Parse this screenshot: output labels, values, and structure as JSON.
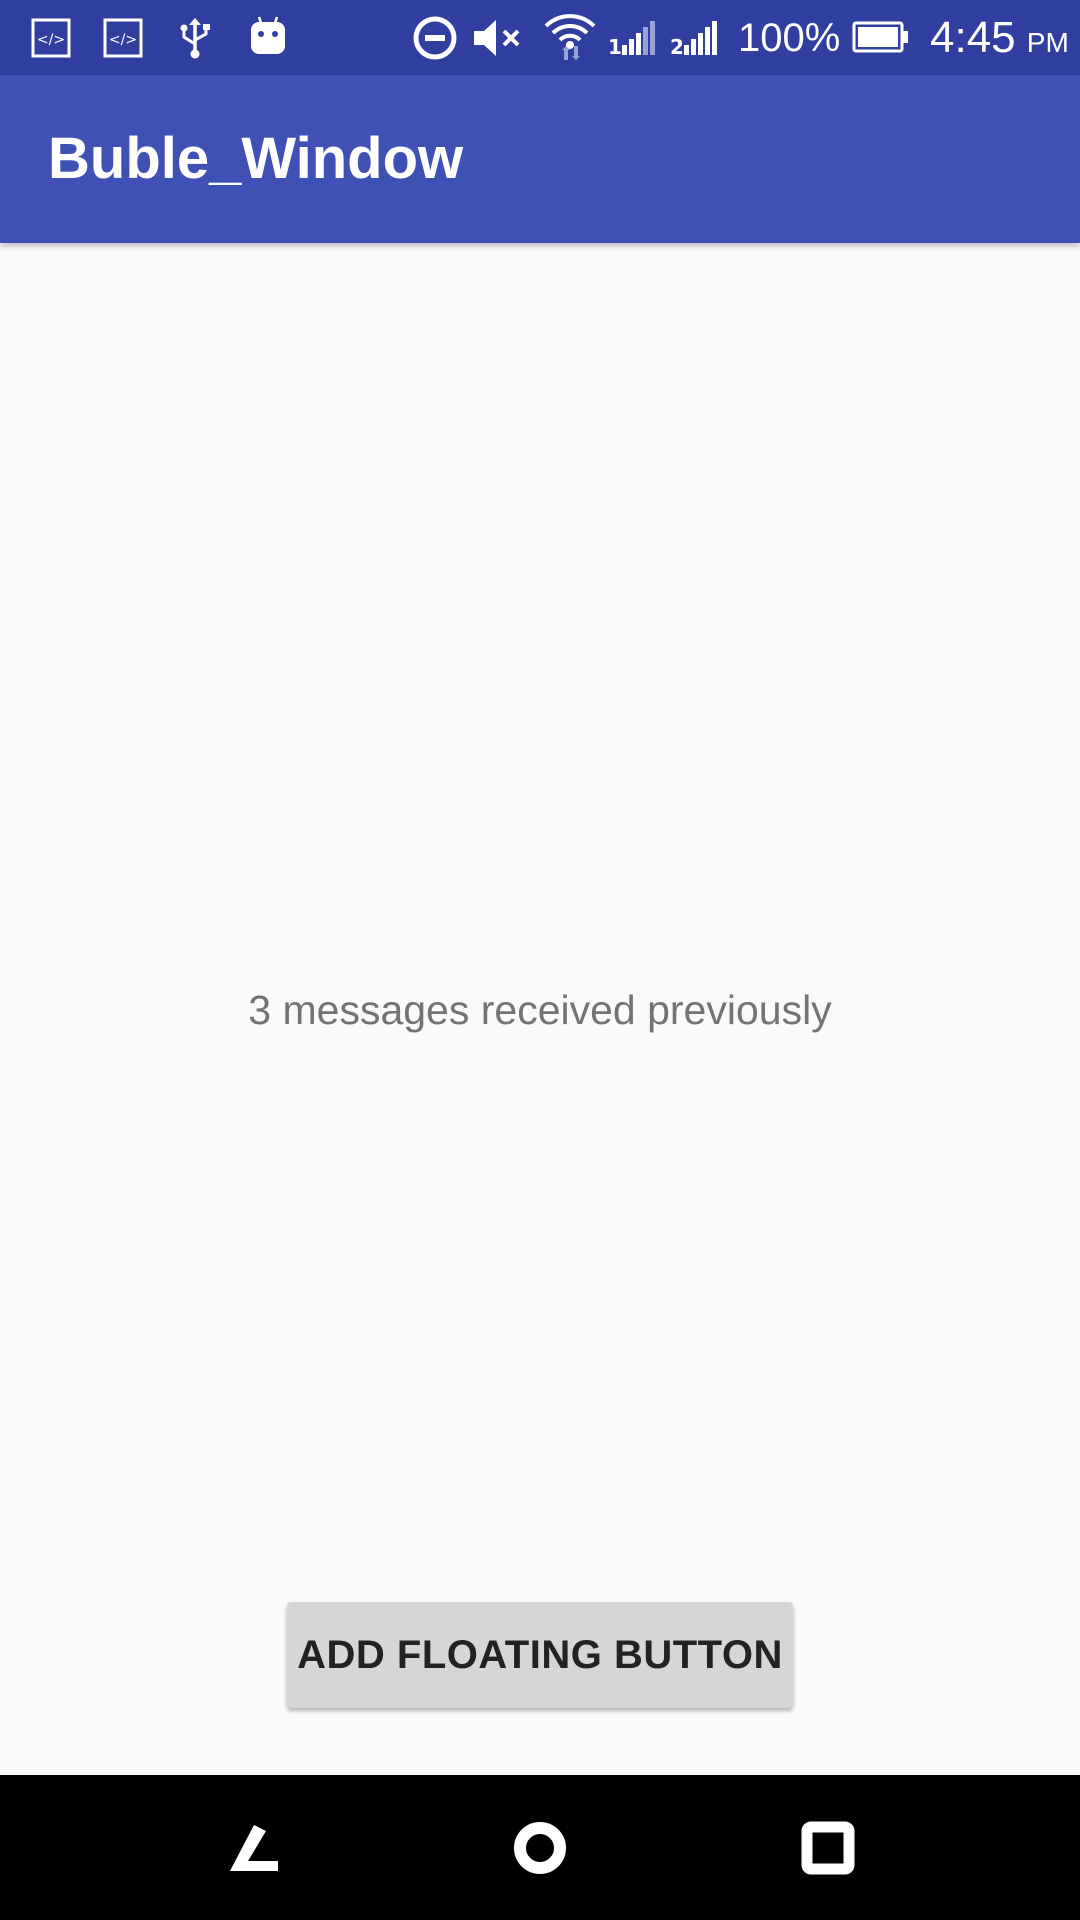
{
  "status_bar": {
    "icons": [
      "code-icon",
      "code-icon",
      "usb-icon",
      "android-icon",
      "do-not-disturb-icon",
      "mute-icon",
      "wifi-icon",
      "signal-sim1-icon",
      "signal-sim2-icon",
      "battery-icon"
    ],
    "battery_percent": "100%",
    "time": "4:45",
    "ampm": "PM",
    "background": "#303f9f"
  },
  "app_bar": {
    "title": "Buble_Window",
    "background": "#3f51b5"
  },
  "main": {
    "message": "3 messages received previously",
    "add_button_label": "ADD FLOATING BUTTON"
  },
  "nav_bar": {
    "icons": [
      "back-icon",
      "home-icon",
      "recents-icon"
    ]
  }
}
